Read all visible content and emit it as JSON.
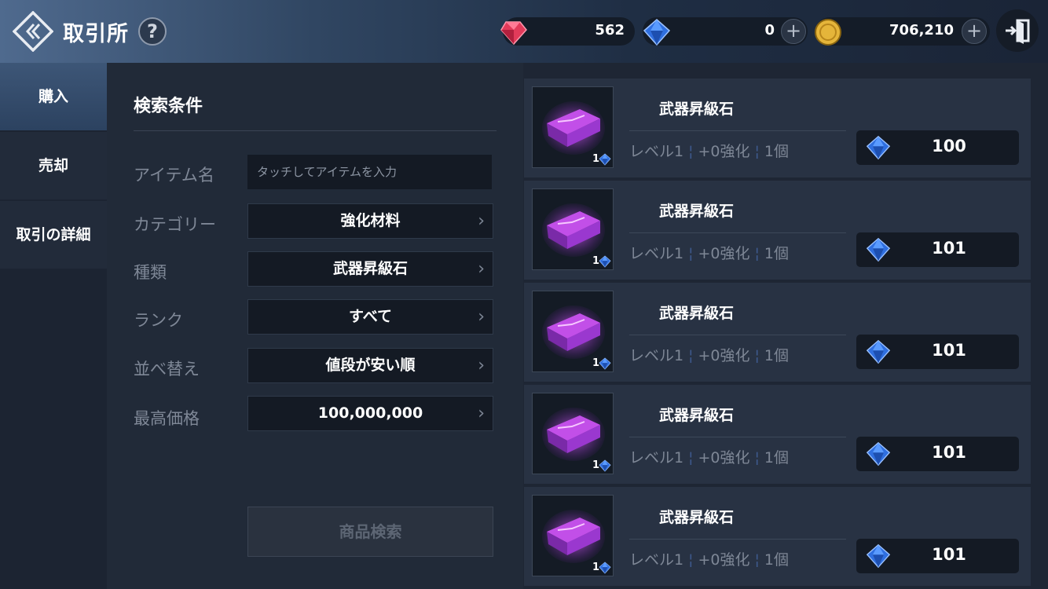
{
  "header": {
    "title": "取引所",
    "help": "?",
    "currencies": [
      {
        "icon": "red-gem-icon",
        "value": "562"
      },
      {
        "icon": "blue-diamond-icon",
        "value": "0",
        "plus": "+"
      },
      {
        "icon": "gold-coin-icon",
        "value": "706,210",
        "plus": "+"
      }
    ]
  },
  "sidebar": {
    "items": [
      {
        "label": "購入",
        "active": true
      },
      {
        "label": "売却"
      },
      {
        "label": "取引の詳細"
      }
    ]
  },
  "search": {
    "title": "検索条件",
    "item_name": {
      "label": "アイテム名",
      "value": "",
      "placeholder": "タッチしてアイテムを入力"
    },
    "fields": [
      {
        "label": "カテゴリー",
        "value": "強化材料"
      },
      {
        "label": "種類",
        "value": "武器昇級石"
      },
      {
        "label": "ランク",
        "value": "すべて"
      },
      {
        "label": "並べ替え",
        "value": "値段が安い順"
      },
      {
        "label": "最高価格",
        "value": "100,000,000"
      }
    ],
    "search_button": "商品検索"
  },
  "listings": [
    {
      "name": "武器昇級石",
      "level": "レベル1",
      "enhance": "+0強化",
      "count": "1個",
      "qty": "1",
      "price": "100"
    },
    {
      "name": "武器昇級石",
      "level": "レベル1",
      "enhance": "+0強化",
      "count": "1個",
      "qty": "1",
      "price": "101"
    },
    {
      "name": "武器昇級石",
      "level": "レベル1",
      "enhance": "+0強化",
      "count": "1個",
      "qty": "1",
      "price": "101"
    },
    {
      "name": "武器昇級石",
      "level": "レベル1",
      "enhance": "+0強化",
      "count": "1個",
      "qty": "1",
      "price": "101"
    },
    {
      "name": "武器昇級石",
      "level": "レベル1",
      "enhance": "+0強化",
      "count": "1個",
      "qty": "1",
      "price": "101"
    }
  ],
  "colors": {
    "accent_blue": "#3e6fd6",
    "gem_purple": "#b13be0",
    "gold": "#e5b53a",
    "ruby": "#e23a5a"
  }
}
